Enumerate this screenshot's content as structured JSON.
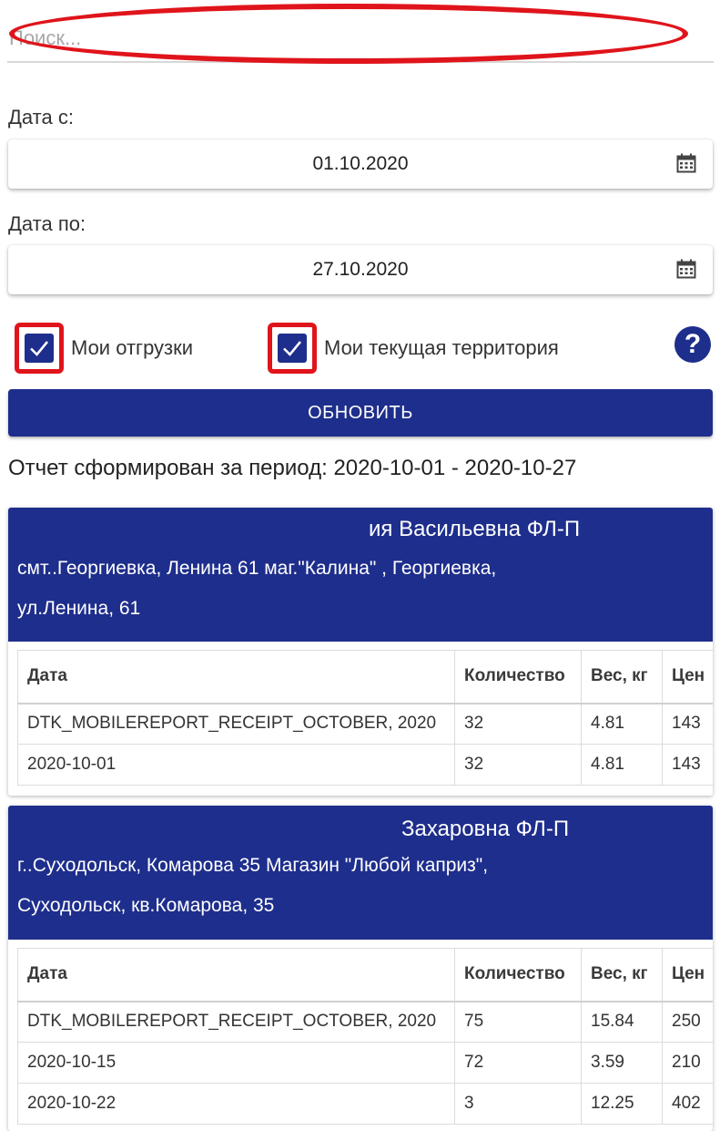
{
  "search": {
    "placeholder": "Поиск..."
  },
  "date_from": {
    "label": "Дата с:",
    "value": "01.10.2020"
  },
  "date_to": {
    "label": "Дата по:",
    "value": "27.10.2020"
  },
  "checkboxes": [
    {
      "label": "Мои отгрузки",
      "checked": true
    },
    {
      "label": "Мои текущая территория",
      "checked": true
    }
  ],
  "help": {
    "glyph": "?"
  },
  "refresh_button": {
    "label": "ОБНОВИТЬ"
  },
  "period_text": "Отчет сформирован за период: 2020-10-01 - 2020-10-27",
  "table_headers": [
    "Дата",
    "Количество",
    "Вес, кг",
    "Цен"
  ],
  "cards": [
    {
      "title": "ия Васильевна ФЛ-П",
      "address_line1": "смт..Георгиевка, Ленина 61 маг.\"Калина\" , Георгиевка,",
      "address_line2": "ул.Ленина, 61",
      "rows": [
        [
          "DTK_MOBILEREPORT_RECEIPT_OCTOBER, 2020",
          "32",
          "4.81",
          "143"
        ],
        [
          "2020-10-01",
          "32",
          "4.81",
          "143"
        ]
      ]
    },
    {
      "title": "Захаровна ФЛ-П",
      "address_line1": "г..Суходольск, Комарова 35 Магазин \"Любой каприз\",",
      "address_line2": "Суходольск, кв.Комарова, 35",
      "rows": [
        [
          "DTK_MOBILEREPORT_RECEIPT_OCTOBER, 2020",
          "75",
          "15.84",
          "250"
        ],
        [
          "2020-10-15",
          "72",
          "3.59",
          "210"
        ],
        [
          "2020-10-22",
          "3",
          "12.25",
          "402"
        ]
      ]
    }
  ],
  "colors": {
    "primary": "#1e2e8c",
    "highlight": "#e0141b"
  }
}
